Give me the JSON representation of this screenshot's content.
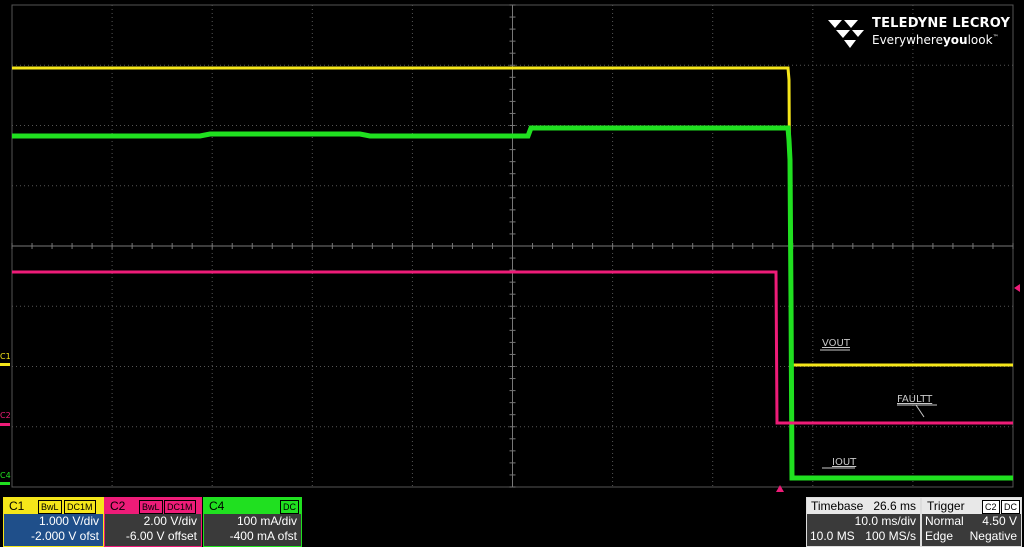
{
  "brand": {
    "name": "TELEDYNE LECROY",
    "tagline_pre": "Everywhere",
    "tagline_bold": "you",
    "tagline_post": "look",
    "tm": "™"
  },
  "channels": [
    {
      "id": "C1",
      "color": "#f5e61a",
      "tags": [
        "BwL",
        "DC1M"
      ],
      "scale": "1.000 V/div",
      "offset": "-2.000 V ofst"
    },
    {
      "id": "C2",
      "color": "#ee1c78",
      "tags": [
        "BwL",
        "DC1M"
      ],
      "scale": "2.00 V/div",
      "offset": "-6.00 V offset"
    },
    {
      "id": "C4",
      "color": "#20e020",
      "tags": [
        "DC"
      ],
      "scale": "100 mA/div",
      "offset": "-400 mA ofst"
    }
  ],
  "trace_labels": {
    "vout": "VOUT",
    "fault": "FAULTT",
    "iout": "IOUT"
  },
  "left_markers": {
    "c1": "C1",
    "c2": "C2",
    "c4": "C4"
  },
  "timebase": {
    "label": "Timebase",
    "delay": "26.6 ms",
    "per_div": "10.0 ms/div",
    "samples": "10.0 MS",
    "rate": "100 MS/s"
  },
  "trigger": {
    "label": "Trigger",
    "source": "C2",
    "coupling": "DC",
    "mode": "Normal",
    "level": "4.50 V",
    "type": "Edge",
    "slope": "Negative"
  }
}
